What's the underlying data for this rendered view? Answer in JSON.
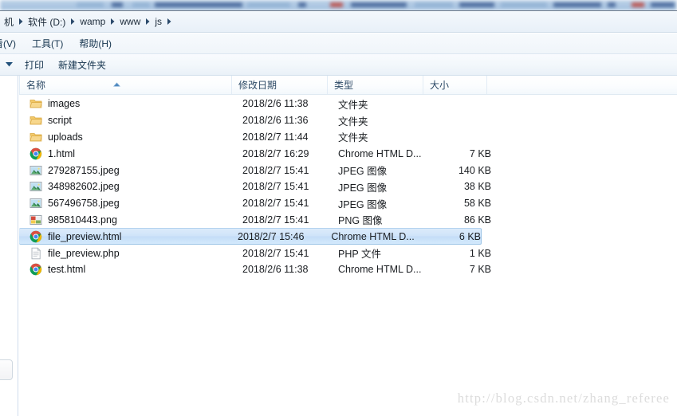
{
  "window": {
    "title": "js",
    "tabstrip_note": "blurred-browser-tab-strip"
  },
  "addressbar": {
    "crumbs": [
      {
        "label": "机",
        "clipped": true
      },
      {
        "label": "软件 (D:)",
        "clipped": false
      },
      {
        "label": "wamp",
        "clipped": false
      },
      {
        "label": "www",
        "clipped": false
      },
      {
        "label": "js",
        "clipped": false
      }
    ]
  },
  "menubar": {
    "items": [
      {
        "label": "看(V)",
        "clipped": true
      },
      {
        "label": "工具(T)",
        "clipped": false
      },
      {
        "label": "帮助(H)",
        "clipped": false
      }
    ]
  },
  "toolbar": {
    "caret": "chevron-down",
    "items": [
      {
        "label": "打印"
      },
      {
        "label": "新建文件夹"
      }
    ]
  },
  "list": {
    "columns": [
      {
        "key": "name",
        "label": "名称",
        "sorted": "asc"
      },
      {
        "key": "date",
        "label": "修改日期",
        "sorted": ""
      },
      {
        "key": "type",
        "label": "类型",
        "sorted": ""
      },
      {
        "key": "size",
        "label": "大小",
        "sorted": ""
      }
    ],
    "rows": [
      {
        "icon": "folder-icon",
        "name": "images",
        "date": "2018/2/6 11:38",
        "type": "文件夹",
        "size": "",
        "selected": false
      },
      {
        "icon": "folder-icon",
        "name": "script",
        "date": "2018/2/6 11:36",
        "type": "文件夹",
        "size": "",
        "selected": false
      },
      {
        "icon": "folder-icon",
        "name": "uploads",
        "date": "2018/2/7 11:44",
        "type": "文件夹",
        "size": "",
        "selected": false
      },
      {
        "icon": "chrome-html-icon",
        "name": "1.html",
        "date": "2018/2/7 16:29",
        "type": "Chrome HTML D...",
        "size": "7 KB",
        "selected": false
      },
      {
        "icon": "jpeg-image-icon",
        "name": "279287155.jpeg",
        "date": "2018/2/7 15:41",
        "type": "JPEG 图像",
        "size": "140 KB",
        "selected": false
      },
      {
        "icon": "jpeg-image-icon",
        "name": "348982602.jpeg",
        "date": "2018/2/7 15:41",
        "type": "JPEG 图像",
        "size": "38 KB",
        "selected": false
      },
      {
        "icon": "jpeg-image-icon",
        "name": "567496758.jpeg",
        "date": "2018/2/7 15:41",
        "type": "JPEG 图像",
        "size": "58 KB",
        "selected": false
      },
      {
        "icon": "png-image-icon",
        "name": "985810443.png",
        "date": "2018/2/7 15:41",
        "type": "PNG 图像",
        "size": "86 KB",
        "selected": false
      },
      {
        "icon": "chrome-html-icon",
        "name": "file_preview.html",
        "date": "2018/2/7 15:46",
        "type": "Chrome HTML D...",
        "size": "6 KB",
        "selected": true
      },
      {
        "icon": "php-file-icon",
        "name": "file_preview.php",
        "date": "2018/2/7 15:41",
        "type": "PHP 文件",
        "size": "1 KB",
        "selected": false
      },
      {
        "icon": "chrome-html-icon",
        "name": "test.html",
        "date": "2018/2/6 11:38",
        "type": "Chrome HTML D...",
        "size": "7 KB",
        "selected": false
      }
    ]
  },
  "watermark": {
    "text": "http://blog.csdn.net/zhang_referee"
  },
  "colors": {
    "selection_fill": "#cfe4f9",
    "selection_border": "#9cc4e6",
    "header_text": "#2d4a66",
    "chrome_red": "#dc4e41",
    "chrome_yellow": "#f4b400",
    "chrome_green": "#0f9d58",
    "chrome_blue": "#4285f4",
    "folder_yellow": "#f6d07a",
    "watermark": "#dcdcdc"
  }
}
